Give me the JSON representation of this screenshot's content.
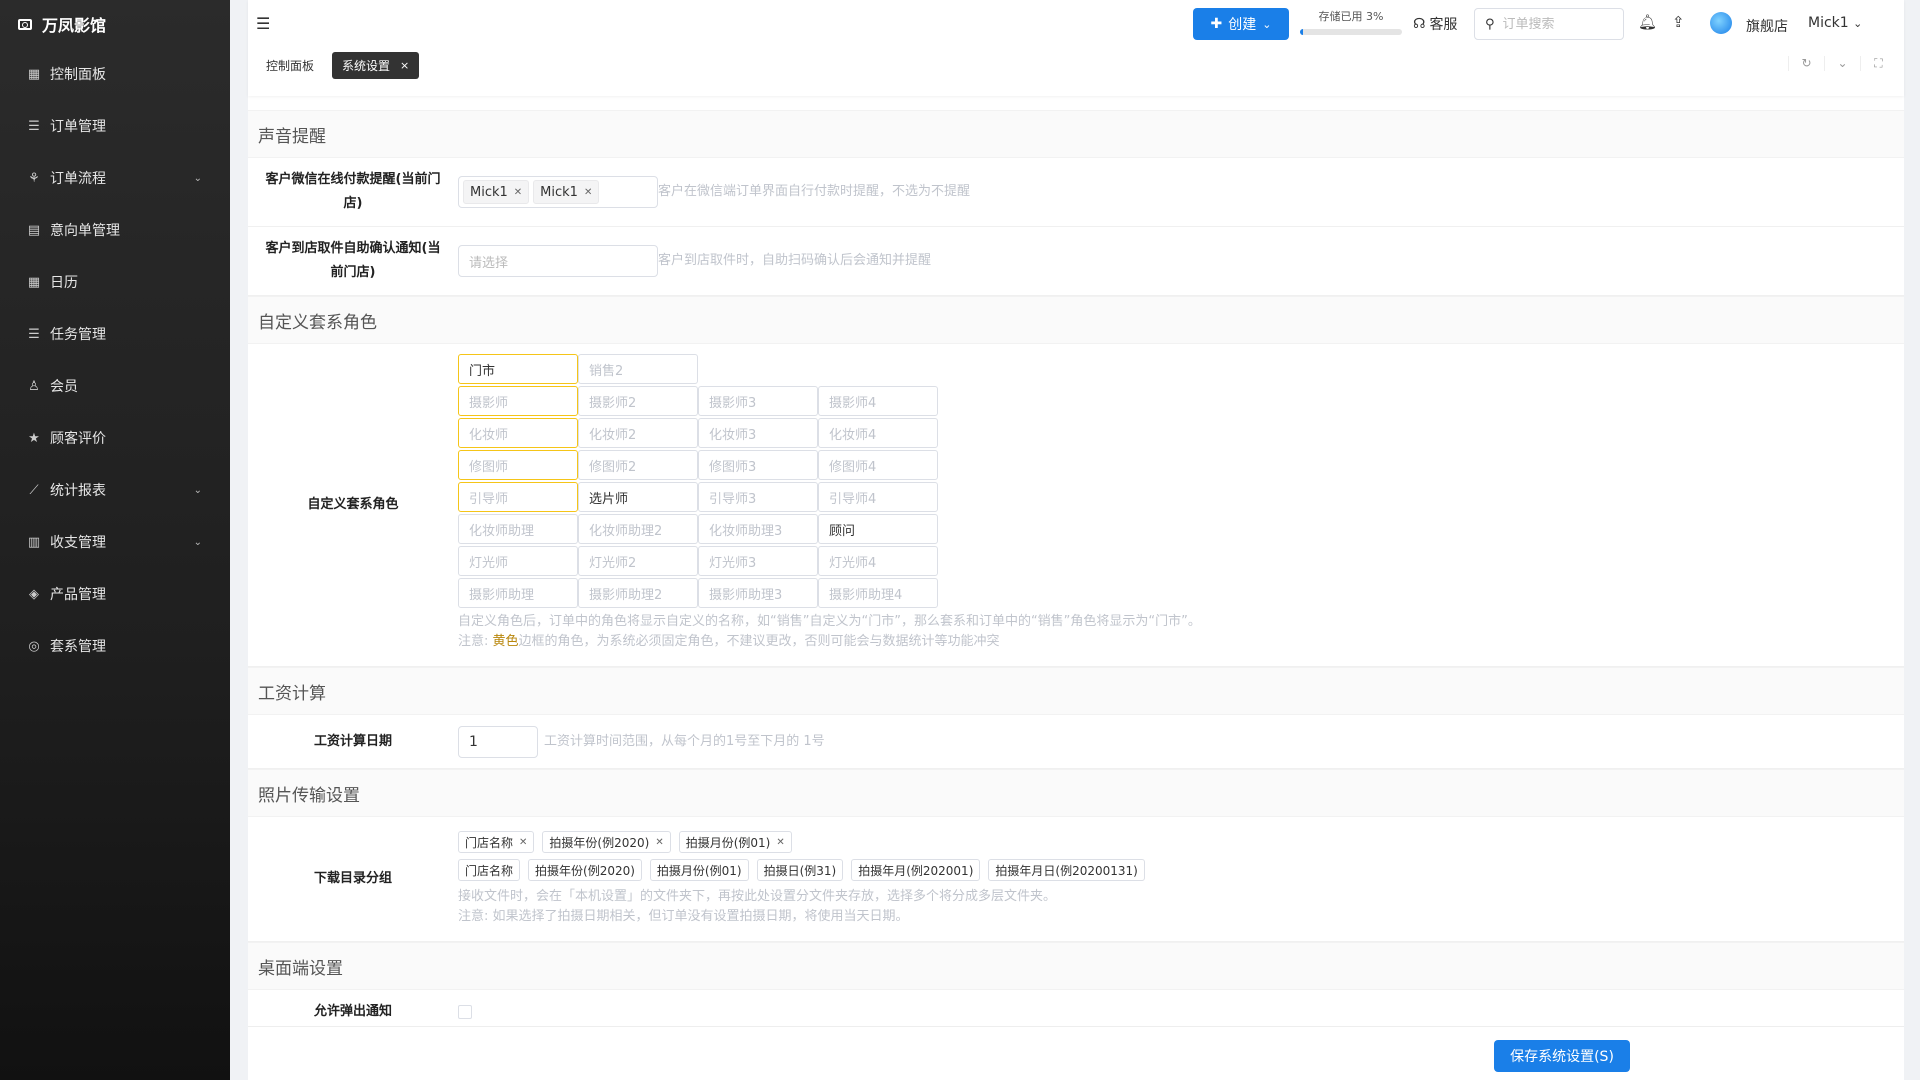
{
  "brand": "万凤影馆",
  "sidebar": {
    "items": [
      {
        "label": "控制面板",
        "icon": "dashboard-icon",
        "glyph": "▦",
        "chev": ""
      },
      {
        "label": "订单管理",
        "icon": "list-icon",
        "glyph": "☰",
        "chev": ""
      },
      {
        "label": "订单流程",
        "icon": "flow-icon",
        "glyph": "⚘",
        "chev": "⌄"
      },
      {
        "label": "意向单管理",
        "icon": "document-icon",
        "glyph": "▤",
        "chev": ""
      },
      {
        "label": "日历",
        "icon": "calendar-icon",
        "glyph": "▦",
        "chev": ""
      },
      {
        "label": "任务管理",
        "icon": "task-icon",
        "glyph": "☰",
        "chev": ""
      },
      {
        "label": "会员",
        "icon": "user-icon",
        "glyph": "♙",
        "chev": ""
      },
      {
        "label": "顾客评价",
        "icon": "star-icon",
        "glyph": "★",
        "chev": ""
      },
      {
        "label": "统计报表",
        "icon": "chart-icon",
        "glyph": "⟋",
        "chev": "⌄"
      },
      {
        "label": "收支管理",
        "icon": "bank-icon",
        "glyph": "▥",
        "chev": "⌄"
      },
      {
        "label": "产品管理",
        "icon": "product-icon",
        "glyph": "◈",
        "chev": ""
      },
      {
        "label": "套系管理",
        "icon": "package-icon",
        "glyph": "◎",
        "chev": ""
      }
    ]
  },
  "header": {
    "create_label": "创建",
    "storage_label": "存储已用 3%",
    "storage_percent": 3,
    "service_label": "客服",
    "search_placeholder": "订单搜索",
    "store_name": "旗舰店",
    "user_name": "Mick1",
    "tabs": [
      {
        "label": "控制面板"
      },
      {
        "label": "系统设置"
      }
    ]
  },
  "sections": {
    "sound": {
      "title": "声音提醒",
      "wechat_label": "客户微信在线付款提醒(当前门店)",
      "wechat_chips": [
        "Mick1",
        "Mick1"
      ],
      "wechat_hint": "客户在微信端订单界面自行付款时提醒，不选为不提醒",
      "pickup_label": "客户到店取件自助确认通知(当前门店)",
      "pickup_placeholder": "请选择",
      "pickup_hint": "客户到店取件时，自助扫码确认后会通知并提醒"
    },
    "roles": {
      "title": "自定义套系角色",
      "label": "自定义套系角色",
      "rows": [
        [
          {
            "t": "门市",
            "f": true,
            "y": true
          },
          {
            "t": "销售2",
            "f": false,
            "y": false
          }
        ],
        [
          {
            "t": "摄影师",
            "f": false,
            "y": true
          },
          {
            "t": "摄影师2",
            "f": false,
            "y": false
          },
          {
            "t": "摄影师3",
            "f": false,
            "y": false
          },
          {
            "t": "摄影师4",
            "f": false,
            "y": false
          }
        ],
        [
          {
            "t": "化妆师",
            "f": false,
            "y": true
          },
          {
            "t": "化妆师2",
            "f": false,
            "y": false
          },
          {
            "t": "化妆师3",
            "f": false,
            "y": false
          },
          {
            "t": "化妆师4",
            "f": false,
            "y": false
          }
        ],
        [
          {
            "t": "修图师",
            "f": false,
            "y": true
          },
          {
            "t": "修图师2",
            "f": false,
            "y": false
          },
          {
            "t": "修图师3",
            "f": false,
            "y": false
          },
          {
            "t": "修图师4",
            "f": false,
            "y": false
          }
        ],
        [
          {
            "t": "引导师",
            "f": false,
            "y": true
          },
          {
            "t": "选片师",
            "f": true,
            "y": false
          },
          {
            "t": "引导师3",
            "f": false,
            "y": false
          },
          {
            "t": "引导师4",
            "f": false,
            "y": false
          }
        ],
        [
          {
            "t": "化妆师助理",
            "f": false,
            "y": false
          },
          {
            "t": "化妆师助理2",
            "f": false,
            "y": false
          },
          {
            "t": "化妆师助理3",
            "f": false,
            "y": false
          },
          {
            "t": "顾问",
            "f": true,
            "y": false
          }
        ],
        [
          {
            "t": "灯光师",
            "f": false,
            "y": false
          },
          {
            "t": "灯光师2",
            "f": false,
            "y": false
          },
          {
            "t": "灯光师3",
            "f": false,
            "y": false
          },
          {
            "t": "灯光师4",
            "f": false,
            "y": false
          }
        ],
        [
          {
            "t": "摄影师助理",
            "f": false,
            "y": false
          },
          {
            "t": "摄影师助理2",
            "f": false,
            "y": false
          },
          {
            "t": "摄影师助理3",
            "f": false,
            "y": false
          },
          {
            "t": "摄影师助理4",
            "f": false,
            "y": false
          }
        ]
      ],
      "hint1": "自定义角色后，订单中的角色将显示自定义的名称，如“销售”自定义为“门市”，那么套系和订单中的“销售”角色将显示为“门市”。",
      "hint2_prefix": "注意: ",
      "hint2_yellow": "黄色",
      "hint2_suffix": "边框的角色，为系统必须固定角色，不建议更改，否则可能会与数据统计等功能冲突"
    },
    "salary": {
      "title": "工资计算",
      "label": "工资计算日期",
      "value": "1",
      "hint": "工资计算时间范围，从每个月的1号至下月的 1号"
    },
    "photo": {
      "title": "照片传输设置",
      "label": "下载目录分组",
      "selected": [
        "门店名称",
        "拍摄年份(例2020)",
        "拍摄月份(例01)"
      ],
      "options": [
        "门店名称",
        "拍摄年份(例2020)",
        "拍摄月份(例01)",
        "拍摄日(例31)",
        "拍摄年月(例202001)",
        "拍摄年月日(例20200131)"
      ],
      "hint1": "接收文件时，会在「本机设置」的文件夹下，再按此处设置分文件夹存放，选择多个将分成多层文件夹。",
      "hint2": "注意: 如果选择了拍摄日期相关，但订单没有设置拍摄日期，将使用当天日期。"
    },
    "desktop": {
      "title": "桌面端设置",
      "popup_label": "允许弹出通知"
    }
  },
  "footer": {
    "save_label": "保存系统设置(S)"
  }
}
